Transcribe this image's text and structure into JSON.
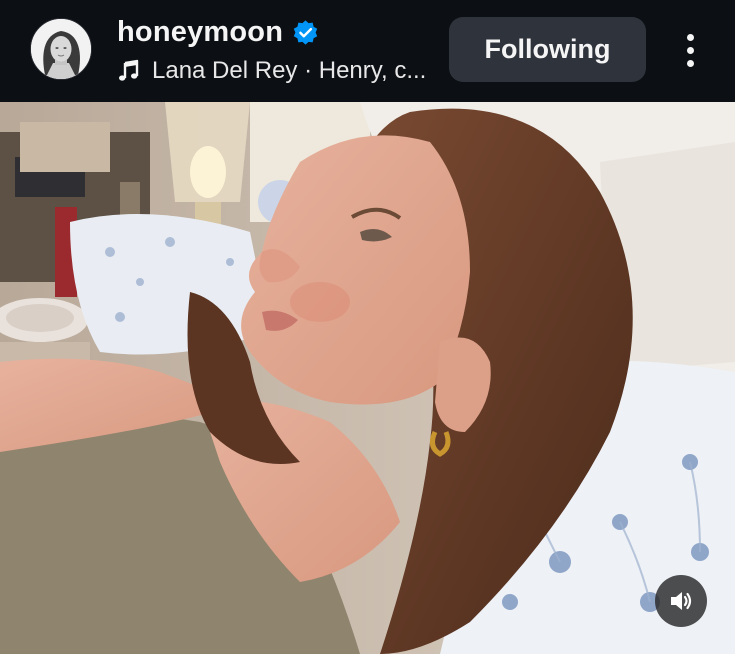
{
  "post": {
    "author": {
      "username": "honeymoon",
      "verified": true,
      "avatar_icon": "profile-avatar"
    },
    "music": {
      "icon": "music-note-icon",
      "text": "Lana Del Rey · Henry, c..."
    },
    "follow_button": {
      "label": "Following"
    },
    "more_icon": "more-vertical-icon",
    "media": {
      "type": "video",
      "sound_icon": "speaker-icon"
    }
  },
  "colors": {
    "header_bg": "#0c0f14",
    "button_bg": "#2f343c",
    "verified_blue": "#0095f6",
    "text_primary": "#f5f5f5"
  }
}
